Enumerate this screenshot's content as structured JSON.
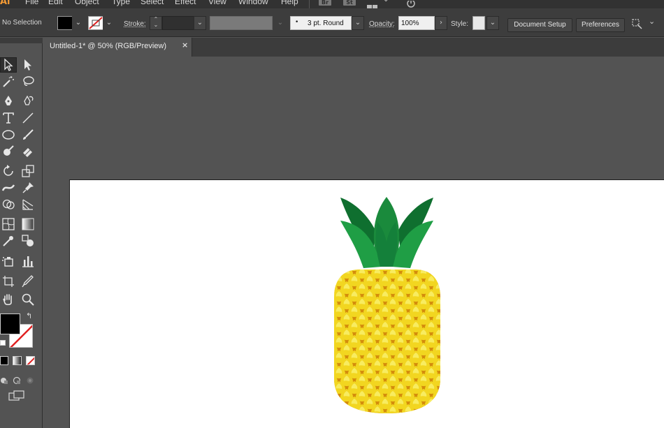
{
  "app": {
    "logo": "Ai",
    "menu": [
      "File",
      "Edit",
      "Object",
      "Type",
      "Select",
      "Effect",
      "View",
      "Window",
      "Help"
    ],
    "app_icons": [
      "Br",
      "St"
    ]
  },
  "control_bar": {
    "selection": "No Selection",
    "stroke_label": "Stroke:",
    "brush_value": "3 pt. Round",
    "opacity_label": "Opacity:",
    "opacity_value": "100%",
    "style_label": "Style:",
    "document_setup": "Document Setup",
    "preferences": "Preferences",
    "fill_color": "#000000",
    "stroke_color": "none"
  },
  "document": {
    "tab_title": "Untitled-1* @ 50% (RGB/Preview)",
    "close_glyph": "×"
  },
  "tools": [
    "selection-tool",
    "direct-selection-tool",
    "magic-wand-tool",
    "lasso-tool",
    "pen-tool",
    "curvature-tool",
    "type-tool",
    "line-tool",
    "ellipse-tool",
    "paintbrush-tool",
    "shaper-tool",
    "eraser-tool",
    "rotate-tool",
    "scale-tool",
    "width-tool",
    "puppet-warp-tool",
    "shape-builder-tool",
    "perspective-grid-tool",
    "mesh-tool",
    "gradient-tool",
    "eyedropper-tool",
    "blend-tool",
    "symbol-sprayer-tool",
    "column-graph-tool",
    "artboard-tool",
    "slice-tool",
    "hand-tool",
    "zoom-tool"
  ],
  "colors": {
    "ui_dark": "#323232",
    "ui_panel": "#535353",
    "pineapple_body": "#f2d620",
    "pineapple_shadow": "#d48d0c",
    "leaf_light": "#1f9e45",
    "leaf_dark": "#0f6f2f"
  },
  "artwork": {
    "subject": "pineapple"
  }
}
